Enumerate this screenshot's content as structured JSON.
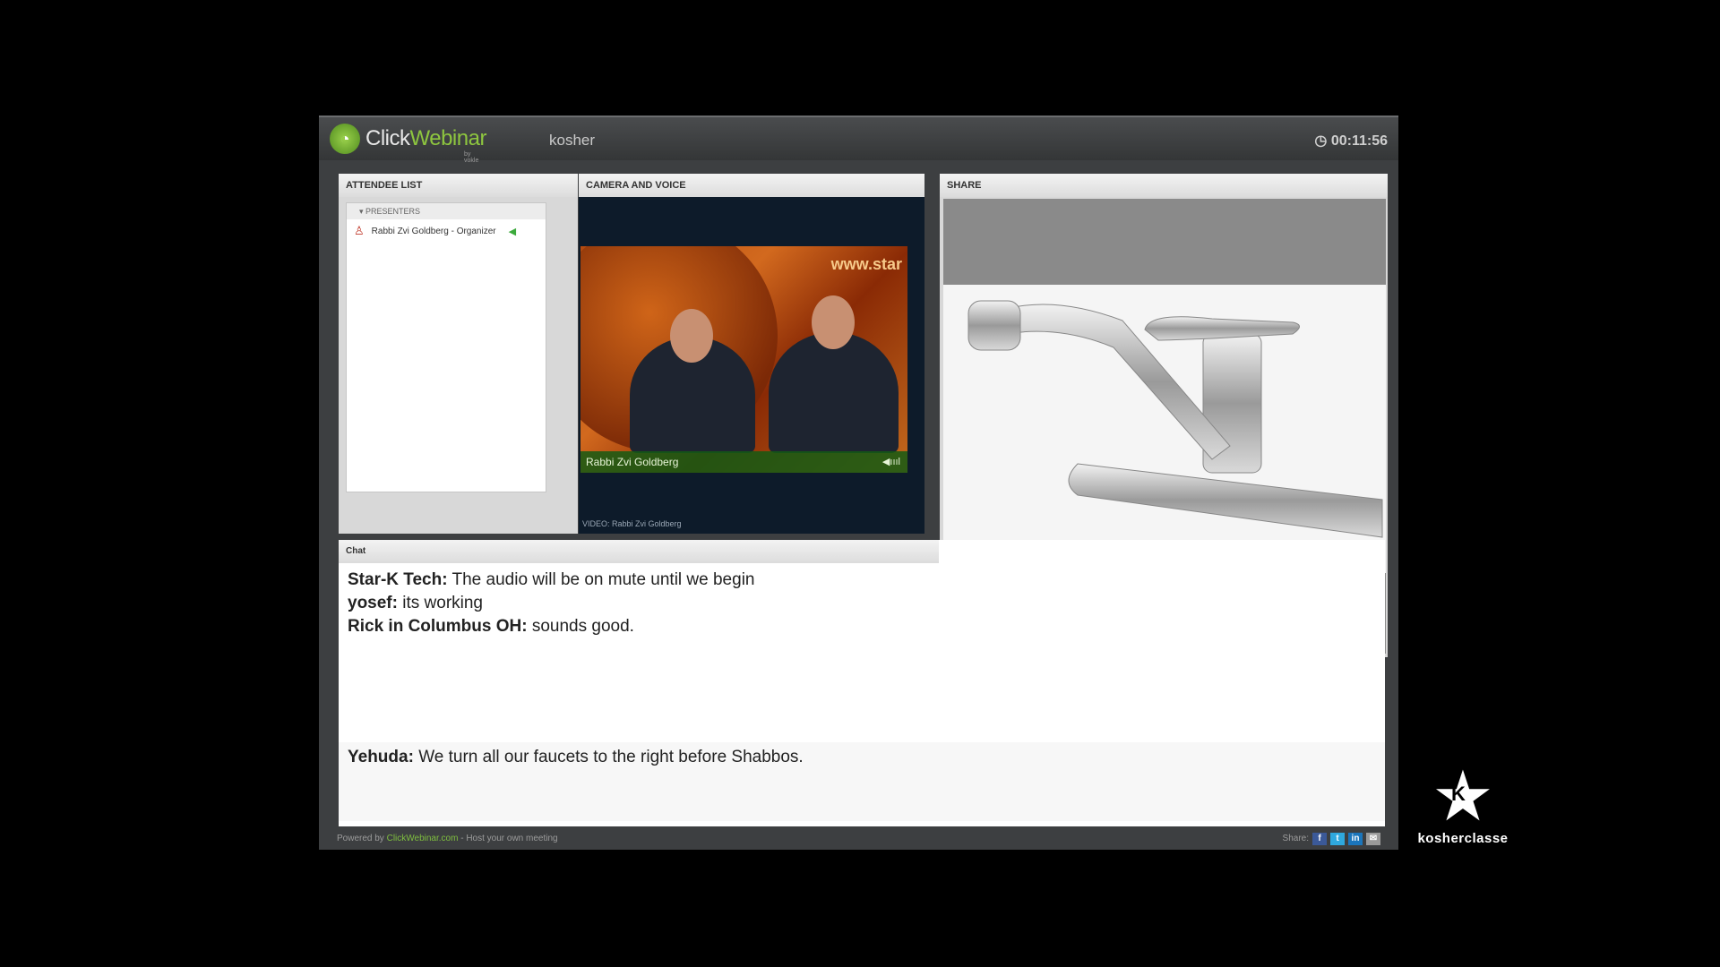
{
  "app": {
    "logo_click": "Click",
    "logo_webinar": "Webinar",
    "logo_sub": "by vokle",
    "room": "kosher",
    "timer": "00:11:56"
  },
  "attendees": {
    "title": "ATTENDEE LIST",
    "group": "PRESENTERS",
    "items": [
      {
        "name": "Rabbi Zvi Goldberg - Organizer"
      }
    ]
  },
  "camera": {
    "title": "CAMERA AND VOICE",
    "site_text": "www.star",
    "caption": "Rabbi Zvi Goldberg",
    "label": "VIDEO: Rabbi Zvi Goldberg"
  },
  "share": {
    "title": "SHARE"
  },
  "chat": {
    "title": "Chat",
    "messages": [
      {
        "author": "Star-K Tech:",
        "text": "The audio will be on mute until we begin"
      },
      {
        "author": "yosef:",
        "text": "its working"
      },
      {
        "author": "Rick in Columbus OH:",
        "text": "sounds good."
      }
    ],
    "draft": {
      "author": "Yehuda:",
      "text": "We turn all our faucets to the right before Shabbos."
    }
  },
  "footer": {
    "powered_by": "Powered by",
    "brand": "ClickWebinar.com",
    "host": "- Host your own meeting",
    "share_label": "Share:"
  },
  "watermark": {
    "text": "kosherclasse"
  }
}
